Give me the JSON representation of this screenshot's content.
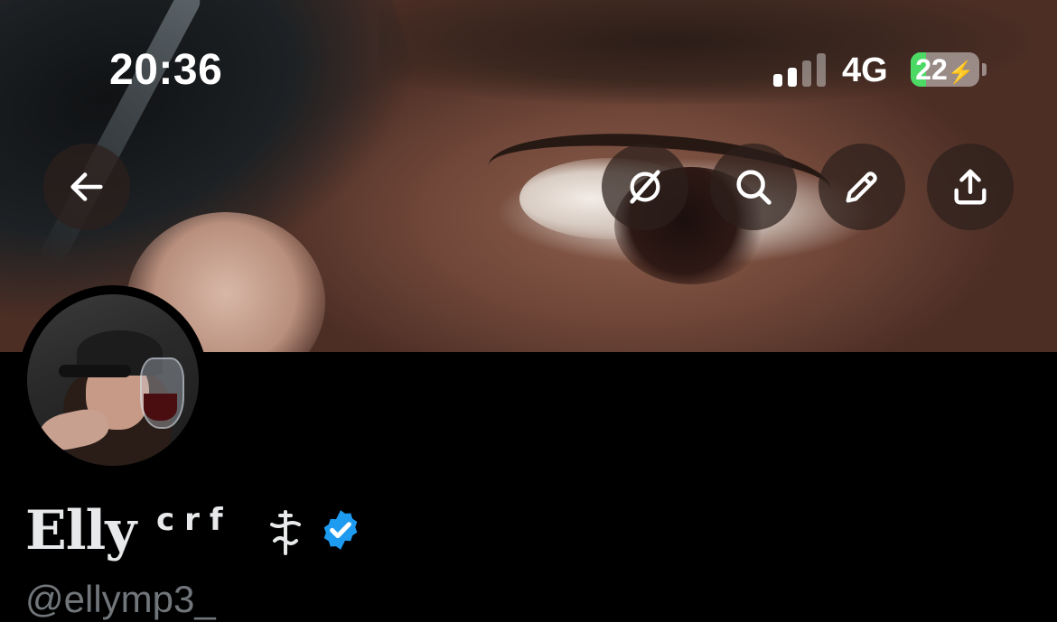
{
  "status_bar": {
    "time": "20:36",
    "network": "4G",
    "battery_percent": "22",
    "battery_level": 0.22,
    "signal_bars": 2,
    "signal_bars_total": 4,
    "battery_color": "#4cd964"
  },
  "header": {
    "back_icon": "arrow-left-icon",
    "actions": [
      "grok-icon",
      "search-icon",
      "pencil-icon",
      "share-icon"
    ]
  },
  "profile": {
    "display_name": "Elly",
    "name_suffix": "crf",
    "name_symbol_icon": "cross-icon",
    "verified_icon": "verified-badge-icon",
    "verified_color": "#1d9bf0",
    "handle": "@ellymp3_"
  }
}
